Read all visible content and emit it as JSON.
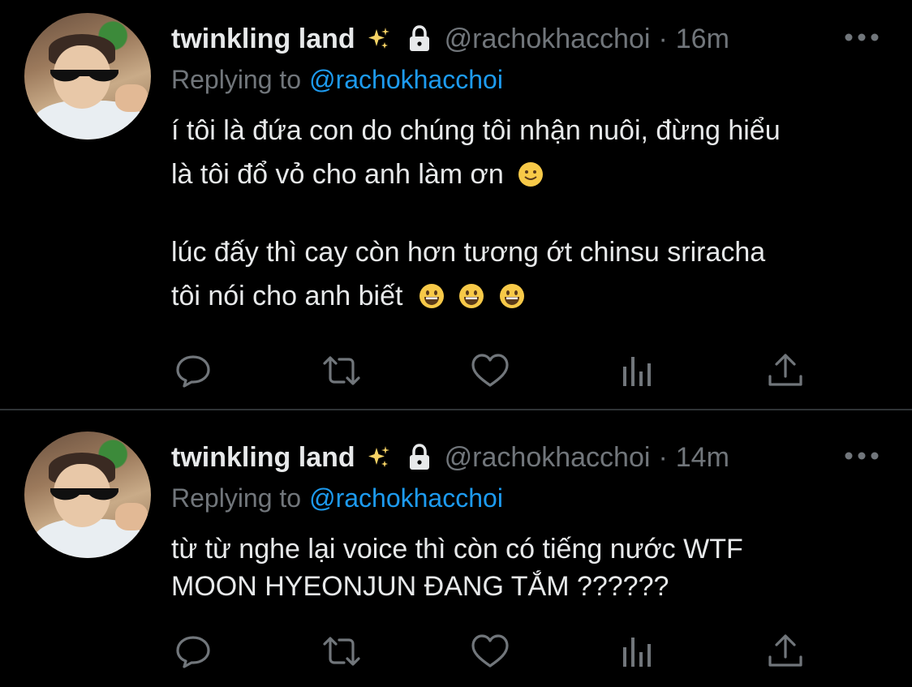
{
  "tweets": [
    {
      "author_name": "twinkling land",
      "author_name_emoji": "sparkles-icon",
      "locked_icon": "lock-icon",
      "handle": "@rachokhacchoi",
      "separator": "·",
      "time": "16m",
      "replying_to_prefix": "Replying to",
      "replying_to_handle": "@rachokhacchoi",
      "text_lines": [
        "í tôi là đứa con do chúng tôi nhận nuôi, đừng hiểu",
        "là tôi đổ vỏ cho anh làm ơn",
        "lúc đấy thì cay còn hơn tương ớt chinsu sriracha",
        "tôi nói cho anh biết"
      ]
    },
    {
      "author_name": "twinkling land",
      "author_name_emoji": "sparkles-icon",
      "locked_icon": "lock-icon",
      "handle": "@rachokhacchoi",
      "separator": "·",
      "time": "14m",
      "replying_to_prefix": "Replying to",
      "replying_to_handle": "@rachokhacchoi",
      "text_lines": [
        "từ từ nghe lại voice thì còn có tiếng nước WTF",
        "MOON HYEONJUN ĐANG TẮM ??????"
      ]
    }
  ],
  "actions": [
    "reply-icon",
    "retweet-icon",
    "like-icon",
    "analytics-icon",
    "share-icon"
  ],
  "colors": {
    "background": "#000000",
    "text": "#e7e9ea",
    "muted": "#71767b",
    "link": "#1d9bf0",
    "divider": "#2f3336"
  }
}
